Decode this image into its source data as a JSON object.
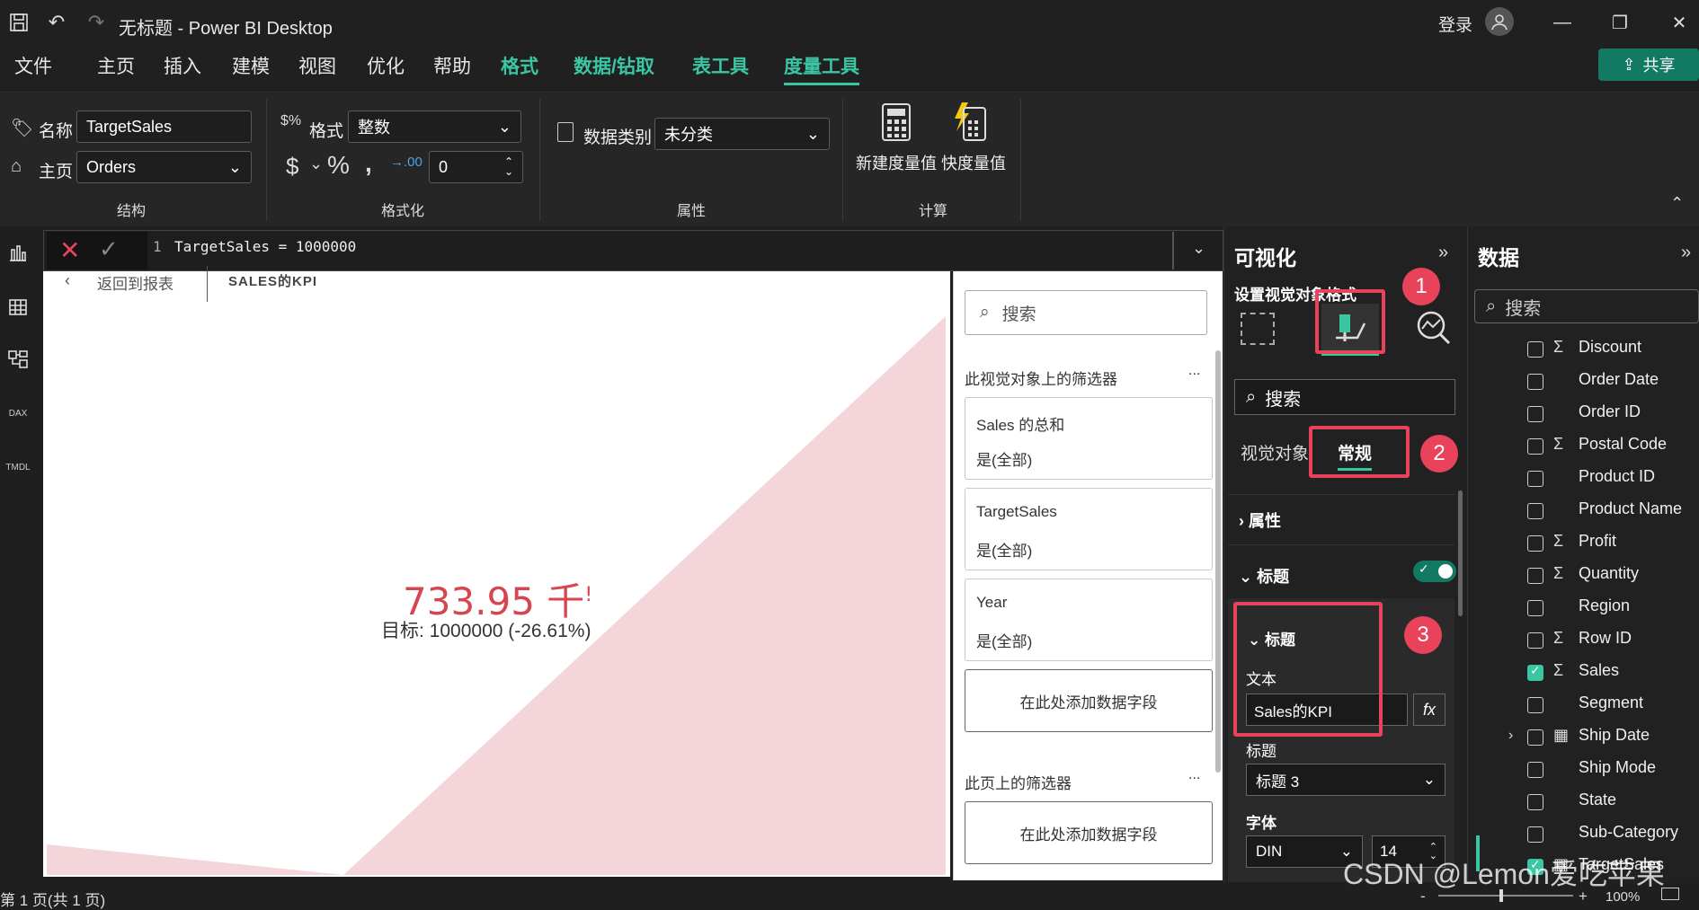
{
  "window": {
    "title": "无标题 - Power BI Desktop",
    "signin": "登录"
  },
  "menu": {
    "items": [
      "文件",
      "主页",
      "插入",
      "建模",
      "视图",
      "优化",
      "帮助",
      "格式",
      "数据/钻取",
      "表工具",
      "度量工具"
    ],
    "share": "共享"
  },
  "ribbon": {
    "name_label": "名称",
    "name_value": "TargetSales",
    "home_label": "主页",
    "home_value": "Orders",
    "format_label": "格式",
    "format_value": "整数",
    "currency": "$",
    "percent": "%",
    "comma": ",",
    "decimals_value": "0",
    "category_label": "数据类别",
    "category_value": "未分类",
    "new_measure": "新建度量值",
    "quick_measure": "快度量值",
    "group_structure": "结构",
    "group_formatting": "格式化",
    "group_properties": "属性",
    "group_calc": "计算"
  },
  "formula": {
    "line_no": "1",
    "text": "TargetSales = 1000000"
  },
  "canvas": {
    "back_link": "返回到报表",
    "visual_title": "SALES的KPI",
    "kpi_value": "733.95 千",
    "kpi_mark": "!",
    "kpi_goal": "目标: 1000000 (-26.61%)",
    "status": "第 1 页(共 1 页)"
  },
  "filters": {
    "search_placeholder": "搜索",
    "visual_section": "此视觉对象上的筛选器",
    "cards": [
      {
        "field": "Sales 的总和",
        "value": "是(全部)"
      },
      {
        "field": "TargetSales",
        "value": "是(全部)"
      },
      {
        "field": "Year",
        "value": "是(全部)"
      }
    ],
    "add_field": "在此处添加数据字段",
    "page_section": "此页上的筛选器",
    "more": "..."
  },
  "viz": {
    "title": "可视化",
    "subtitle": "设置视觉对象格式",
    "search_placeholder": "搜索",
    "tab_visual": "视觉对象",
    "tab_general": "常规",
    "section_props": "属性",
    "section_title": "标题",
    "inner_title": "标题",
    "text_label": "文本",
    "text_value": "Sales的KPI",
    "heading_label": "标题",
    "heading_value": "标题 3",
    "font_label": "字体",
    "font_value": "DIN",
    "font_size": "14",
    "badge1": "1",
    "badge2": "2",
    "badge3": "3",
    "fx": "fx"
  },
  "data": {
    "title": "数据",
    "search_placeholder": "搜索",
    "fields": [
      {
        "name": "Discount",
        "sigma": true,
        "checked": false,
        "table_icon": false,
        "expand": false
      },
      {
        "name": "Order Date",
        "sigma": false,
        "checked": false,
        "table_icon": false,
        "expand": false
      },
      {
        "name": "Order ID",
        "sigma": false,
        "checked": false,
        "table_icon": false,
        "expand": false
      },
      {
        "name": "Postal Code",
        "sigma": true,
        "checked": false,
        "table_icon": false,
        "expand": false
      },
      {
        "name": "Product ID",
        "sigma": false,
        "checked": false,
        "table_icon": false,
        "expand": false
      },
      {
        "name": "Product Name",
        "sigma": false,
        "checked": false,
        "table_icon": false,
        "expand": false
      },
      {
        "name": "Profit",
        "sigma": true,
        "checked": false,
        "table_icon": false,
        "expand": false
      },
      {
        "name": "Quantity",
        "sigma": true,
        "checked": false,
        "table_icon": false,
        "expand": false
      },
      {
        "name": "Region",
        "sigma": false,
        "checked": false,
        "table_icon": false,
        "expand": false
      },
      {
        "name": "Row ID",
        "sigma": true,
        "checked": false,
        "table_icon": false,
        "expand": false
      },
      {
        "name": "Sales",
        "sigma": true,
        "checked": true,
        "table_icon": false,
        "expand": false
      },
      {
        "name": "Segment",
        "sigma": false,
        "checked": false,
        "table_icon": false,
        "expand": false
      },
      {
        "name": "Ship Date",
        "sigma": false,
        "checked": false,
        "table_icon": true,
        "expand": true
      },
      {
        "name": "Ship Mode",
        "sigma": false,
        "checked": false,
        "table_icon": false,
        "expand": false
      },
      {
        "name": "State",
        "sigma": false,
        "checked": false,
        "table_icon": false,
        "expand": false
      },
      {
        "name": "Sub-Category",
        "sigma": false,
        "checked": false,
        "table_icon": false,
        "expand": false
      },
      {
        "name": "TargetSales",
        "sigma": false,
        "checked": true,
        "table_icon": true,
        "expand": false
      }
    ]
  },
  "status": {
    "zoom": "100%"
  },
  "watermark": "CSDN @Lemon爱吃苹果",
  "colors": {
    "accent": "#3bc6a3",
    "highlight": "#e8435a",
    "kpi": "#d64550",
    "area": "#f4d6da"
  }
}
